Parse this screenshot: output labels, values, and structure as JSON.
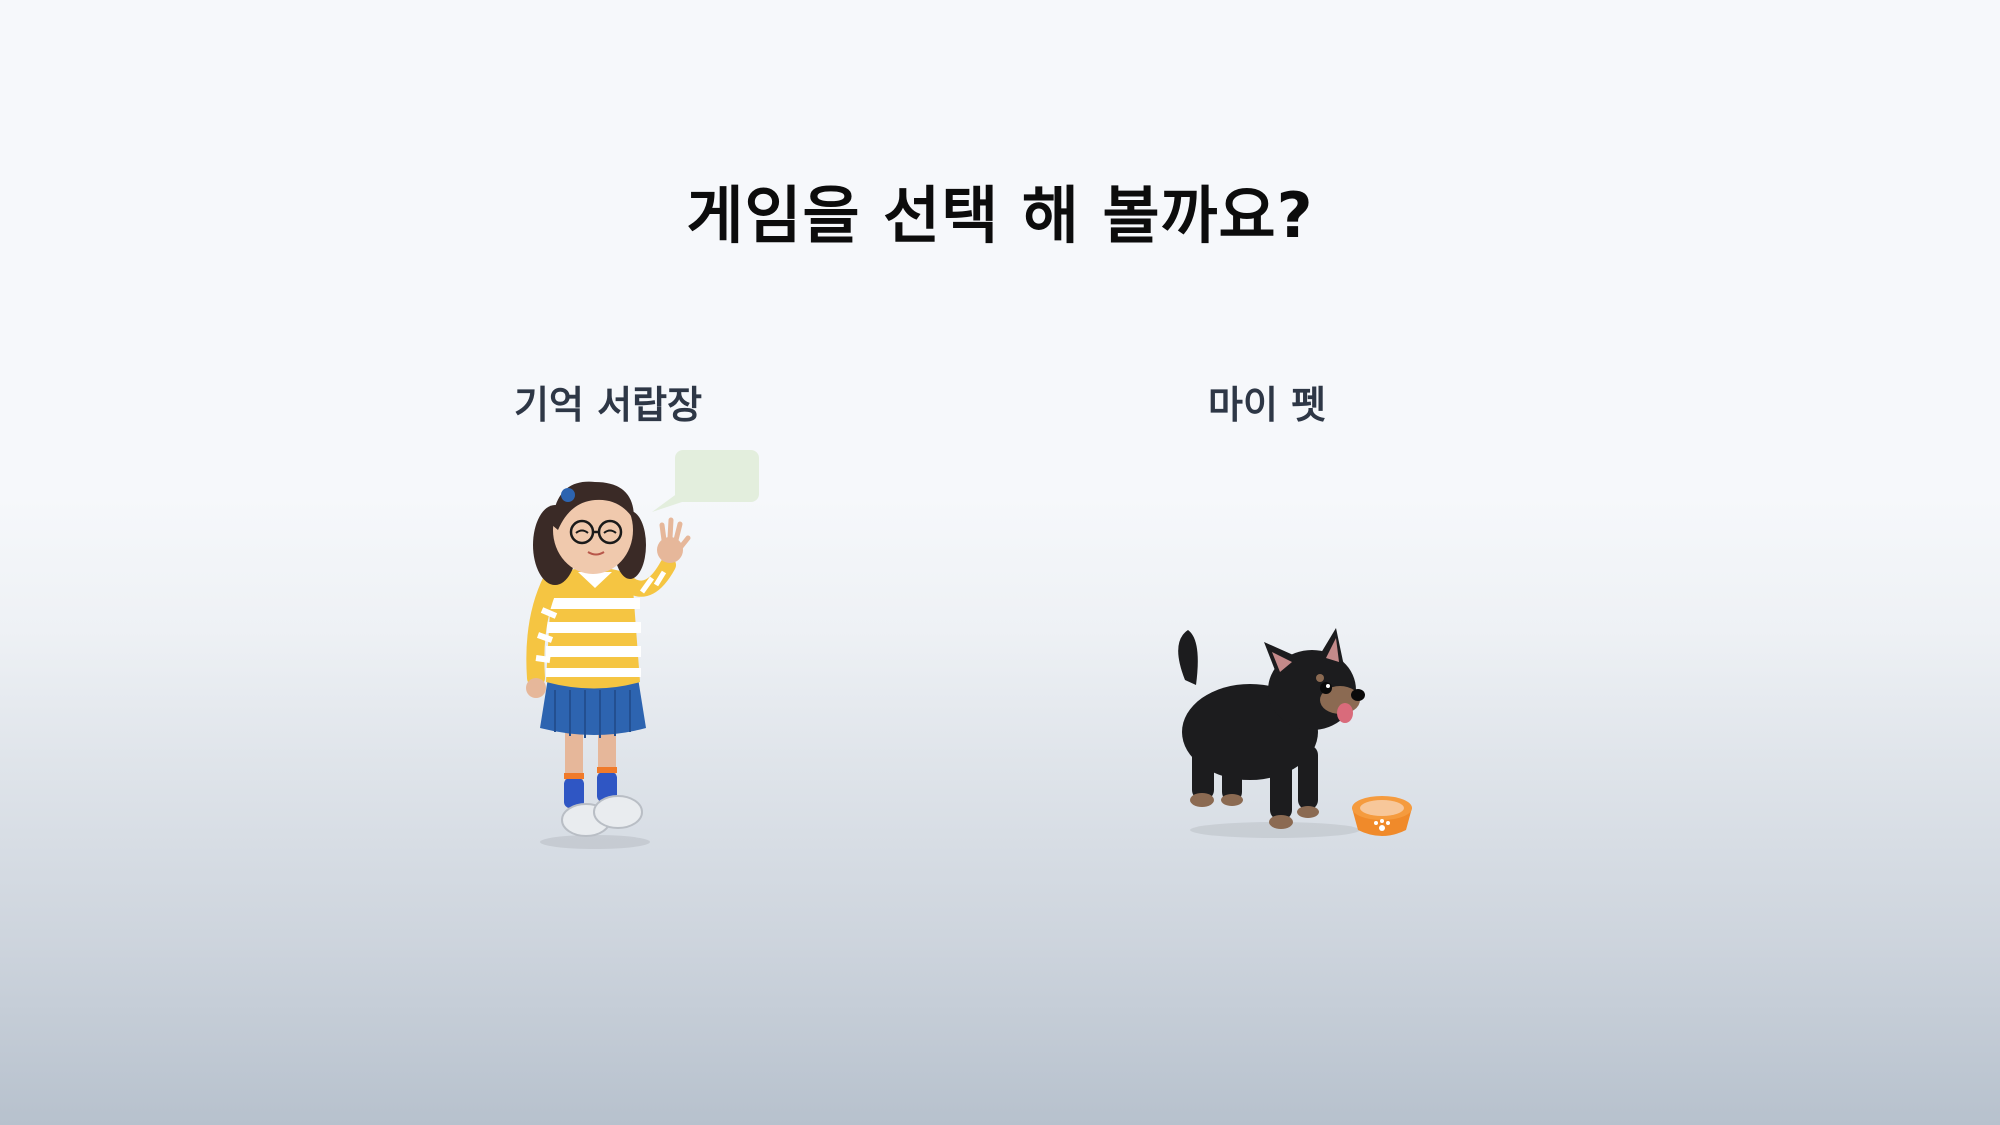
{
  "title": "게임을 선택 해 볼까요?",
  "games": [
    {
      "label": "기억 서랍장",
      "character_icon": "girl-character-icon",
      "speech_bubble_icon": "speech-bubble-icon"
    },
    {
      "label": "마이 펫",
      "character_icon": "dog-character-icon",
      "bowl_icon": "pet-bowl-icon"
    }
  ],
  "colors": {
    "title": "#0c0c0c",
    "label": "#2e3746",
    "speech_bubble": "#e3eedd",
    "bowl": "#f08a2a"
  }
}
